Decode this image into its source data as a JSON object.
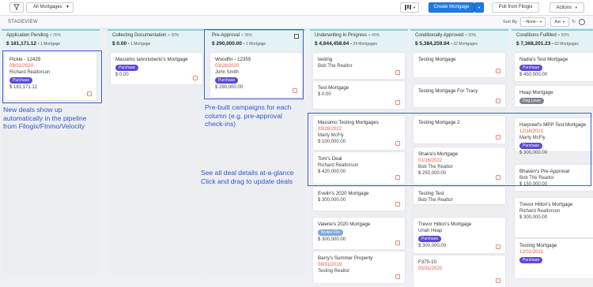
{
  "toolbar": {
    "filter_icon": "filter-icon",
    "dropdown_label": "All Mortgages",
    "view_icon": "kanban-icon",
    "create_label": "Create Mortgage",
    "pull_label": "Pull from Filogix",
    "actions_label": "Actions"
  },
  "stagebar": {
    "title": "STAGEVIEW",
    "sort_label": "Sort By",
    "sort_value": "--None--",
    "order_value": "Asc"
  },
  "columns": [
    {
      "title": "Application Pending",
      "pct": "> 20%",
      "amount": "$ 181,171.12",
      "count": "• 1 Mortgage",
      "cards": [
        {
          "name": "Pickle - 12429",
          "date": "08/31/2020",
          "person": "Richard Realtorson",
          "tag": "Purchase",
          "tag_style": "",
          "amount": "$ 181,171.12"
        }
      ]
    },
    {
      "title": "Collecting Documentation",
      "pct": "> 30%",
      "amount": "$ 0.00",
      "count": "• 1 Mortgage",
      "cards": [
        {
          "name": "Massimo Iannriuberto's Mortgage",
          "date": "",
          "person": "",
          "tag": "Purchase",
          "tag_style": "",
          "amount": "$ 0.00"
        }
      ]
    },
    {
      "title": "Pre-Approval",
      "pct": "> 35%",
      "amount": "$ 290,000.00",
      "count": "• 1 Mortgage",
      "cards": [
        {
          "name": "Woodfin - 12355",
          "date": "03/28/2020",
          "person": "John Smith",
          "tag": "Purchase",
          "tag_style": "",
          "amount": "$ 290,000.00"
        }
      ]
    },
    {
      "title": "Underwriting In Progress",
      "pct": "> 40%",
      "amount": "$ 4,644,458.64",
      "count": "• 24 Mortgages",
      "cards": [
        {
          "name": "testing",
          "date": "",
          "person": "Bob The Realtor",
          "tag": "",
          "tag_style": "",
          "amount": ""
        },
        {
          "name": "Test Mortgage",
          "date": "",
          "person": "",
          "tag": "",
          "tag_style": "",
          "amount": "$ 0.00"
        },
        {
          "name": "Massimo Testing Mortgages",
          "date": "03/28/2022",
          "person": "Marty McFly",
          "tag": "",
          "tag_style": "",
          "amount": "$ 100,000.00"
        },
        {
          "name": "Tom's Deal",
          "date": "",
          "person": "Richard Realtorson",
          "tag": "",
          "tag_style": "",
          "amount": "$ 420,000.00"
        },
        {
          "name": "Evelin's 2020 Mortgage",
          "date": "",
          "person": "",
          "tag": "",
          "tag_style": "",
          "amount": "$ 300,000.00"
        },
        {
          "name": "Valerie's 2020 Mortgage",
          "date": "",
          "person": "",
          "tag": "Broker File",
          "tag_style": "blue",
          "amount": "$ 300,000.00"
        },
        {
          "name": "Barry's Summer Property",
          "date": "08/31/2019",
          "person": "Testing Realtor",
          "tag": "",
          "tag_style": "",
          "amount": ""
        }
      ]
    },
    {
      "title": "Conditionally Approved",
      "pct": "> 50%",
      "amount": "$ 5,384,259.94",
      "count": "• 32 Mortgages",
      "cards": [
        {
          "name": "Testing Mortgage",
          "date": "",
          "person": "",
          "tag": "",
          "tag_style": "",
          "amount": ""
        },
        {
          "name": "Testing Mortgage For Tracy",
          "date": "",
          "person": "",
          "tag": "",
          "tag_style": "",
          "amount": ""
        },
        {
          "name": "Testing Mortgage 2",
          "date": "",
          "person": "",
          "tag": "",
          "tag_style": "",
          "amount": ""
        },
        {
          "name": "Shaira's Mortgage",
          "date": "01/16/2022",
          "person": "Bob The Realtor",
          "tag": "",
          "tag_style": "",
          "amount": "$ 250,000.00"
        },
        {
          "name": "Testing Test",
          "date": "",
          "person": "Bob The Realtor",
          "tag": "",
          "tag_style": "",
          "amount": ""
        },
        {
          "name": "Trevor Hilton's Mortgage",
          "date": "",
          "person": "Uriah Heap",
          "tag": "Purchase",
          "tag_style": "",
          "amount": "$ 300,000.00"
        },
        {
          "name": "F370-10",
          "date": "05/31/2020",
          "person": "",
          "tag": "",
          "tag_style": "",
          "amount": ""
        }
      ]
    },
    {
      "title": "Conditions Fulfilled",
      "pct": "> 50%",
      "amount": "$ 7,368,201.23",
      "count": "• 62 Mortgages",
      "cards": [
        {
          "name": "Nadia's Test Mortgage",
          "date": "",
          "person": "",
          "tag": "Purchase",
          "tag_style": "",
          "amount": "$ 450,000.00"
        },
        {
          "name": "Heap Mortgage",
          "date": "",
          "person": "",
          "tag": "Dog Lover",
          "tag_style": "gray",
          "amount": ""
        },
        {
          "name": "Harpreet's MPP Test Mortgage",
          "date": "12/16/2021",
          "person": "Marty McFly",
          "tag": "Purchase",
          "tag_style": "",
          "amount": "$ 300,000.00"
        },
        {
          "name": "Bhaven's Pre-Approval",
          "date": "",
          "person": "Bob The Realtor",
          "tag": "",
          "tag_style": "",
          "amount": "$ 150,000.00"
        },
        {
          "name": "Trevor Hilton's Mortgage",
          "date": "",
          "person": "Richard Realtorson",
          "tag": "",
          "tag_style": "",
          "amount": "$ 300,000.00"
        },
        {
          "name": "Testing Mortgage",
          "date": "12/01/2021",
          "person": "",
          "tag": "Purchase",
          "tag_style": "",
          "amount": ""
        }
      ]
    }
  ],
  "annotations": {
    "a1": [
      "New deals show up",
      "automatically in the pipeline",
      "from Filogix/FInmo/Velocity"
    ],
    "a2": [
      "Pre-built campaigns for each",
      "column (e.g. pre-approval",
      "check-ins)"
    ],
    "a3": [
      "See all deal details at-a-glance",
      "Click and drag to update deals"
    ]
  }
}
